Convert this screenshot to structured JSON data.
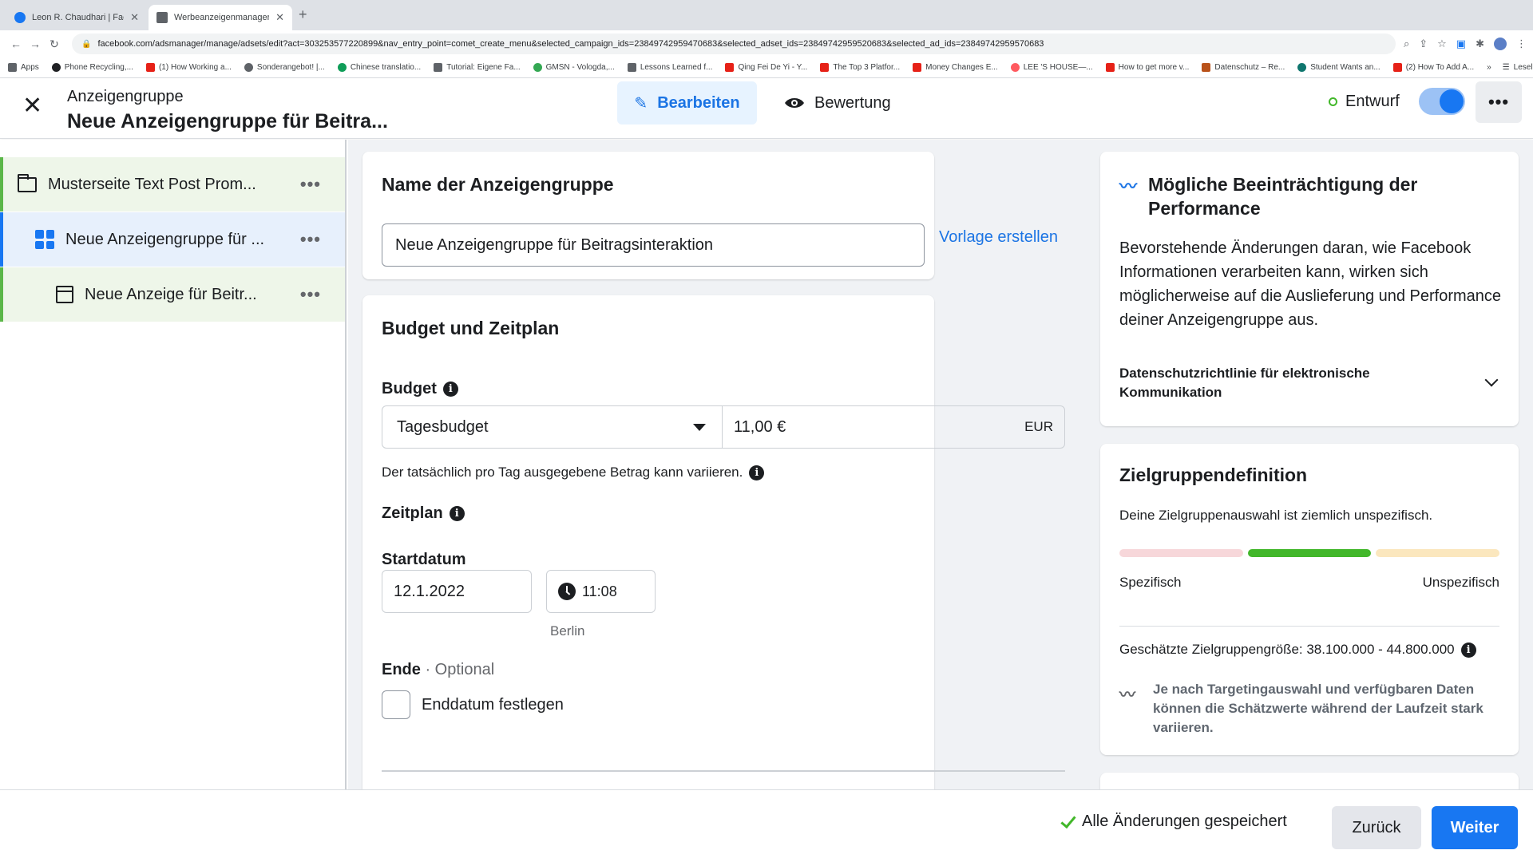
{
  "browser": {
    "tabs": [
      {
        "title": "Leon R. Chaudhari | Facebook",
        "icon": "facebook-icon",
        "color": "#1877f2"
      },
      {
        "title": "Werbeanzeigenmanager - Wer",
        "icon": "ads-manager-icon",
        "color": "#5f6368"
      }
    ],
    "url": "facebook.com/adsmanager/manage/adsets/edit?act=303253577220899&nav_entry_point=comet_create_menu&selected_campaign_ids=23849742959470683&selected_adset_ids=23849742959520683&selected_ad_ids=23849742959570683",
    "bookmarks": [
      {
        "label": "Apps",
        "color": "#5f6368"
      },
      {
        "label": "Phone Recycling,...",
        "color": "#202124"
      },
      {
        "label": "(1) How Working a...",
        "color": "#e62117"
      },
      {
        "label": "Sonderangebot! |...",
        "color": "#5f6368"
      },
      {
        "label": "Chinese translatio...",
        "color": "#0f9d58"
      },
      {
        "label": "Tutorial: Eigene Fa...",
        "color": "#5f6368"
      },
      {
        "label": "GMSN - Vologda,...",
        "color": "#34a853"
      },
      {
        "label": "Lessons Learned f...",
        "color": "#5f6368"
      },
      {
        "label": "Qing Fei De Yi - Y...",
        "color": "#e62117"
      },
      {
        "label": "The Top 3 Platfor...",
        "color": "#e62117"
      },
      {
        "label": "Money Changes E...",
        "color": "#e62117"
      },
      {
        "label": "LEE 'S HOUSE—...",
        "color": "#ff5a5f"
      },
      {
        "label": "How to get more v...",
        "color": "#e62117"
      },
      {
        "label": "Datenschutz – Re...",
        "color": "#b9521a"
      },
      {
        "label": "Student Wants an...",
        "color": "#0f766e"
      },
      {
        "label": "(2) How To Add A...",
        "color": "#e62117"
      }
    ],
    "reading_list": "Leseliste"
  },
  "header": {
    "subtitle": "Anzeigengruppe",
    "title": "Neue Anzeigengruppe für Beitra...",
    "edit_label": "Bearbeiten",
    "review_label": "Bewertung",
    "status_label": "Entwurf",
    "more_label": "•••"
  },
  "sidebar": {
    "campaign": "Musterseite Text Post Prom...",
    "adset": "Neue Anzeigengruppe für ...",
    "ad": "Neue Anzeige für Beitr...",
    "more": "•••"
  },
  "name_card": {
    "title": "Name der Anzeigengruppe",
    "value": "Neue Anzeigengruppe für Beitragsinteraktion",
    "template_link": "Vorlage erstellen"
  },
  "budget_card": {
    "title": "Budget und Zeitplan",
    "budget_label": "Budget",
    "budget_type": "Tagesbudget",
    "budget_amount": "11,00 €",
    "currency": "EUR",
    "hint": "Der tatsächlich pro Tag ausgegebene Betrag kann variieren.",
    "schedule_label": "Zeitplan",
    "start_label": "Startdatum",
    "start_date": "12.1.2022",
    "start_time": "11:08",
    "timezone": "Berlin",
    "end_label": "Ende",
    "end_optional": " · Optional",
    "end_checkbox": "Enddatum festlegen"
  },
  "perf_card": {
    "title": "Mögliche Beeinträchtigung der Performance",
    "body": "Bevorstehende Änderungen daran, wie Facebook Informationen verarbeiten kann, wirken sich möglicherweise auf die Auslieferung und Performance deiner Anzeigengruppe aus.",
    "policy": "Datenschutzrichtlinie für elektronische Kommunikation"
  },
  "audience_card": {
    "title": "Zielgruppendefinition",
    "description": "Deine Zielgruppenauswahl ist ziemlich unspezifisch.",
    "low_label": "Spezifisch",
    "high_label": "Unspezifisch",
    "bar_colors": [
      "#f7d7da",
      "#42b72a",
      "#fbe7be"
    ],
    "size_text": "Geschätzte Zielgruppengröße: 38.100.000 - 44.800.000",
    "note": "Je nach Targetingauswahl und verfügbaren Daten können die Schätzwerte während der Laufzeit stark variieren."
  },
  "footer": {
    "saved": "Alle Änderungen gespeichert",
    "back": "Zurück",
    "next": "Weiter"
  },
  "colors": {
    "accent": "#1877f2",
    "success": "#42b72a"
  }
}
